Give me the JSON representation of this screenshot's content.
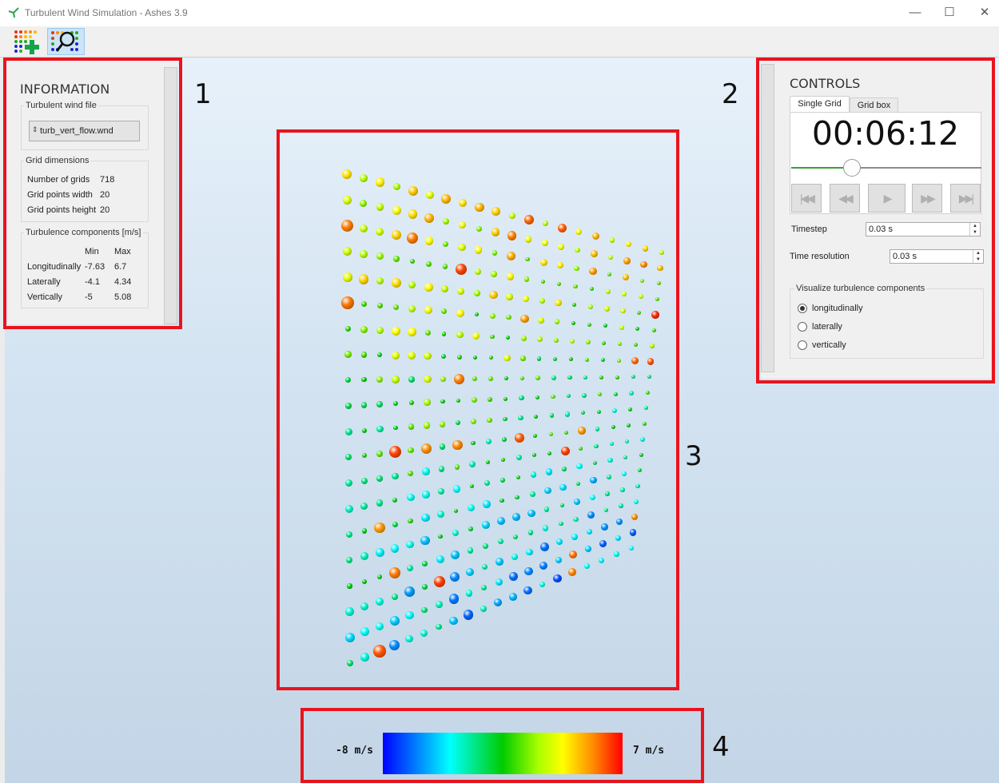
{
  "window": {
    "title": "Turbulent Wind Simulation - Ashes 3.9",
    "minimize": "—",
    "maximize": "☐",
    "close": "✕"
  },
  "toolbar": {
    "icons": [
      "add-grid-icon",
      "inspect-grid-icon"
    ]
  },
  "information": {
    "title": "INFORMATION",
    "file_group": "Turbulent wind file",
    "file_value": "turb_vert_flow.wnd",
    "dims_group": "Grid dimensions",
    "dims": [
      {
        "label": "Number of grids",
        "value": "718"
      },
      {
        "label": "Grid points width",
        "value": "20"
      },
      {
        "label": "Grid points height",
        "value": "20"
      }
    ],
    "turb_group": "Turbulence components [m/s]",
    "turb_headers": {
      "min": "Min",
      "max": "Max"
    },
    "turb": [
      {
        "label": "Longitudinally",
        "min": "-7.63",
        "max": "6.7"
      },
      {
        "label": "Laterally",
        "min": "-4.1",
        "max": "4.34"
      },
      {
        "label": "Vertically",
        "min": "-5",
        "max": "5.08"
      }
    ]
  },
  "controls": {
    "title": "CONTROLS",
    "tabs": [
      "Single Grid",
      "Grid box"
    ],
    "active_tab": 0,
    "time": "00:06:12",
    "slider_fraction": 0.3,
    "timestep_label": "Timestep",
    "timestep_value": "0.03 s",
    "resolution_label": "Time resolution",
    "resolution_value": "0.03 s",
    "visualize_group": "Visualize turbulence components",
    "options": [
      "longitudinally",
      "laterally",
      "vertically"
    ],
    "selected_option": 0
  },
  "legend": {
    "min_label": "-8 m/s",
    "max_label": "7 m/s"
  },
  "callouts": [
    "1",
    "2",
    "3",
    "4"
  ],
  "colors": {
    "highlight": "#e8141d",
    "slider": "#3aa13a",
    "panel": "#f0f0f0"
  }
}
